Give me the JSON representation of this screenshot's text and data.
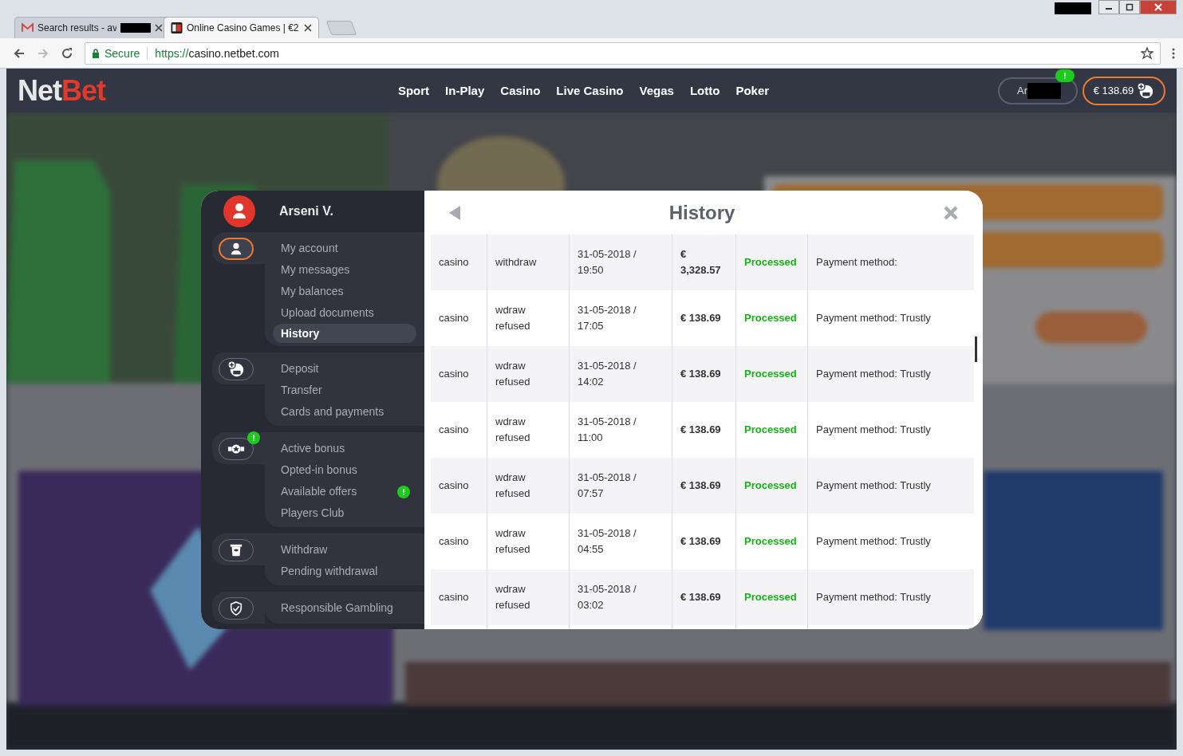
{
  "browser": {
    "tabs": [
      {
        "title": "Search results - av",
        "redacted": true,
        "selected": false
      },
      {
        "title": "Online Casino Games | €2",
        "redacted": false,
        "selected": true
      }
    ],
    "secure_label": "Secure",
    "url_scheme": "https://",
    "url_host": "casino.netbet.com"
  },
  "header": {
    "logo": [
      "Net",
      "Bet"
    ],
    "nav": [
      "Sport",
      "In-Play",
      "Casino",
      "Live Casino",
      "Vegas",
      "Lotto",
      "Poker"
    ],
    "account": {
      "name": "Ar",
      "badge": "!"
    },
    "balance": "€ 138.69"
  },
  "modal": {
    "user": "Arseni V.",
    "title": "History",
    "groups": [
      {
        "active": true,
        "items": [
          {
            "label": "My account",
            "selected": false
          },
          {
            "label": "My messages",
            "selected": false
          },
          {
            "label": "My balances",
            "selected": false
          },
          {
            "label": "Upload documents",
            "selected": false
          },
          {
            "label": "History",
            "selected": true
          }
        ]
      },
      {
        "active": false,
        "items": [
          {
            "label": "Deposit",
            "selected": false
          },
          {
            "label": "Transfer",
            "selected": false
          },
          {
            "label": "Cards and payments",
            "selected": false
          }
        ]
      },
      {
        "badge": "!",
        "active": false,
        "items": [
          {
            "label": "Active bonus",
            "selected": false
          },
          {
            "label": "Opted-in bonus",
            "selected": false
          },
          {
            "label": "Available offers",
            "selected": false,
            "badge": "!"
          },
          {
            "label": "Players Club",
            "selected": false
          }
        ]
      },
      {
        "active": false,
        "items": [
          {
            "label": "Withdraw",
            "selected": false
          },
          {
            "label": "Pending withdrawal",
            "selected": false
          }
        ]
      },
      {
        "active": false,
        "items": [
          {
            "label": "Responsible Gambling",
            "selected": false
          }
        ]
      }
    ],
    "rows": [
      {
        "product": "casino",
        "type": "withdraw",
        "date": "31-05-2018 /",
        "time": "19:50",
        "amount": [
          "€",
          "3,328.57"
        ],
        "status": "Processed",
        "note": "Payment method:"
      },
      {
        "product": "casino",
        "type": "wdraw refused",
        "date": "31-05-2018 /",
        "time": "17:05",
        "amount": [
          "€ 138.69"
        ],
        "status": "Processed",
        "note": "Payment method: Trustly"
      },
      {
        "product": "casino",
        "type": "wdraw refused",
        "date": "31-05-2018 /",
        "time": "14:02",
        "amount": [
          "€ 138.69"
        ],
        "status": "Processed",
        "note": "Payment method: Trustly"
      },
      {
        "product": "casino",
        "type": "wdraw refused",
        "date": "31-05-2018 /",
        "time": "11:00",
        "amount": [
          "€ 138.69"
        ],
        "status": "Processed",
        "note": "Payment method: Trustly"
      },
      {
        "product": "casino",
        "type": "wdraw refused",
        "date": "31-05-2018 /",
        "time": "07:57",
        "amount": [
          "€ 138.69"
        ],
        "status": "Processed",
        "note": "Payment method: Trustly"
      },
      {
        "product": "casino",
        "type": "wdraw refused",
        "date": "31-05-2018 /",
        "time": "04:55",
        "amount": [
          "€ 138.69"
        ],
        "status": "Processed",
        "note": "Payment method: Trustly"
      },
      {
        "product": "casino",
        "type": "wdraw refused",
        "date": "31-05-2018 /",
        "time": "03:02",
        "amount": [
          "€ 138.69"
        ],
        "status": "Processed",
        "note": "Payment method: Trustly"
      }
    ]
  }
}
